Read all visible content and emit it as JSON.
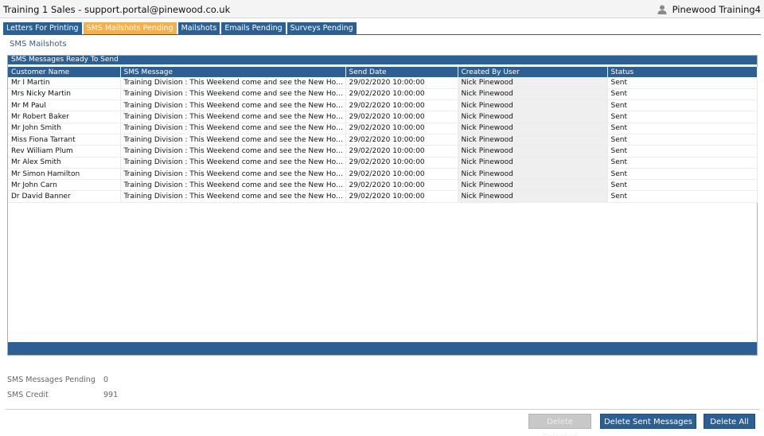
{
  "titlebar": {
    "title": "Training 1 Sales - support.portal@pinewood.co.uk",
    "user_name": "Pinewood Training4"
  },
  "tabs": [
    {
      "label": "Letters For Printing",
      "active": false
    },
    {
      "label": "SMS Mailshots Pending",
      "active": true
    },
    {
      "label": "Mailshots",
      "active": false
    },
    {
      "label": "Emails Pending",
      "active": false
    },
    {
      "label": "Surveys Pending",
      "active": false
    }
  ],
  "breadcrumb": "SMS Mailshots",
  "panel": {
    "title": "SMS Messages Ready To Send",
    "columns": [
      "Customer Name",
      "SMS Message",
      "Send Date",
      "Created By User",
      "Status"
    ],
    "rows": [
      [
        "Mr I Martin",
        "Training Division : This Weekend come and see the New Hon...",
        "29/02/2020 10:00:00",
        "Nick Pinewood",
        "Sent"
      ],
      [
        "Mrs Nicky Martin",
        "Training Division : This Weekend come and see the New Hon...",
        "29/02/2020 10:00:00",
        "Nick Pinewood",
        "Sent"
      ],
      [
        "Mr M Paul",
        "Training Division : This Weekend come and see the New Hon...",
        "29/02/2020 10:00:00",
        "Nick Pinewood",
        "Sent"
      ],
      [
        "Mr Robert Baker",
        "Training Division : This Weekend come and see the New Hon...",
        "29/02/2020 10:00:00",
        "Nick Pinewood",
        "Sent"
      ],
      [
        "Mr John Smith",
        "Training Division : This Weekend come and see the New Hon...",
        "29/02/2020 10:00:00",
        "Nick Pinewood",
        "Sent"
      ],
      [
        "Miss Fiona Tarrant",
        "Training Division : This Weekend come and see the New Hon...",
        "29/02/2020 10:00:00",
        "Nick Pinewood",
        "Sent"
      ],
      [
        "Rev William Plum",
        "Training Division : This Weekend come and see the New Hon...",
        "29/02/2020 10:00:00",
        "Nick Pinewood",
        "Sent"
      ],
      [
        "Mr Alex Smith",
        "Training Division : This Weekend come and see the New Hon...",
        "29/02/2020 10:00:00",
        "Nick Pinewood",
        "Sent"
      ],
      [
        "Mr Simon Hamilton",
        "Training Division : This Weekend come and see the New Hon...",
        "29/02/2020 10:00:00",
        "Nick Pinewood",
        "Sent"
      ],
      [
        "Mr John Carn",
        "Training Division : This Weekend come and see the New Hon...",
        "29/02/2020 10:00:00",
        "Nick Pinewood",
        "Sent"
      ],
      [
        "Dr David Banner",
        "Training Division : This Weekend come and see the New Hon...",
        "29/02/2020 10:00:00",
        "Nick Pinewood",
        "Sent"
      ]
    ]
  },
  "stats": {
    "pending_label": "SMS Messages Pending",
    "pending_value": "0",
    "credit_label": "SMS Credit",
    "credit_value": "991"
  },
  "buttons": {
    "delete_selected": "Delete Selected",
    "delete_sent": "Delete Sent Messages",
    "delete_all": "Delete All"
  },
  "colors": {
    "accent": "#2c5f94",
    "active_tab": "#f5b04b"
  }
}
